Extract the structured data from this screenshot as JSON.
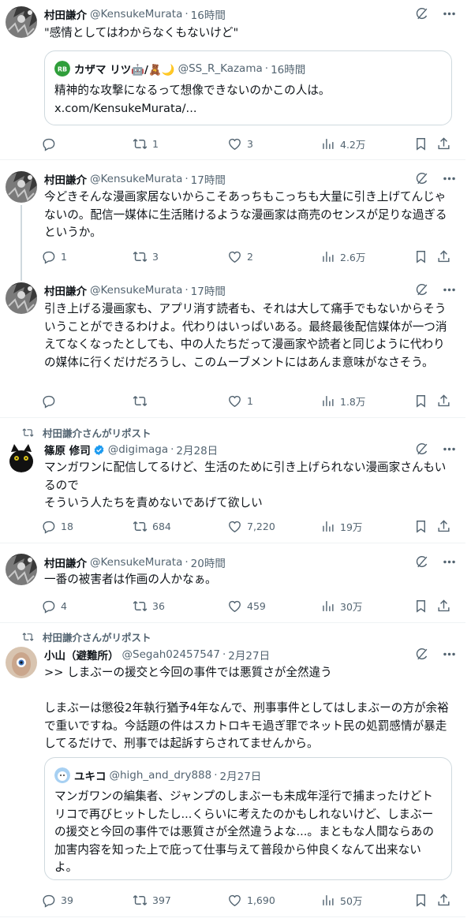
{
  "tweets": [
    {
      "author": "村田謙介",
      "handle": "@KensukeMurata",
      "sep": "·",
      "time": "16時間",
      "text": "\"感情としてはわからなくもないけど\"",
      "quote": {
        "author": "カザマ リツ🤖/🧸🌙",
        "handle": "@SS_R_Kazama",
        "sep": "·",
        "time": "16時間",
        "text": "精神的な攻撃になるって想像できないのかこの人は。\nx.com/KensukeMurata/..."
      },
      "stats": {
        "replies": "",
        "reposts": "1",
        "likes": "3",
        "views": "4.2万"
      }
    },
    {
      "author": "村田謙介",
      "handle": "@KensukeMurata",
      "sep": "·",
      "time": "17時間",
      "text": "今どきそんな漫画家居ないからこそあっちもこっちも大量に引き上げてんじゃないの。配信一媒体に生活賭けるような漫画家は商売のセンスが足りな過ぎるというか。",
      "stats": {
        "replies": "1",
        "reposts": "3",
        "likes": "2",
        "views": "2.6万"
      }
    },
    {
      "author": "村田謙介",
      "handle": "@KensukeMurata",
      "sep": "·",
      "time": "17時間",
      "text": "引き上げる漫画家も、アプリ消す読者も、それは大して痛手でもないからそういうことができるわけよ。代わりはいっぱいある。最終最後配信媒体が一つ消えてなくなったとしても、中の人たちだって漫画家や読者と同じように代わりの媒体に行くだけだろうし、このムーブメントにはあんま意味がなさそう。",
      "stats": {
        "replies": "",
        "reposts": "",
        "likes": "1",
        "views": "1.8万"
      }
    },
    {
      "repost_label": "村田謙介さんがリポスト",
      "author": "篠原 修司",
      "handle": "@digimaga",
      "sep": "·",
      "time": "2月28日",
      "text": "マンガワンに配信してるけど、生活のために引き上げられない漫画家さんもいるので\nそういう人たちを責めないであげて欲しい",
      "stats": {
        "replies": "18",
        "reposts": "684",
        "likes": "7,220",
        "views": "19万"
      }
    },
    {
      "author": "村田謙介",
      "handle": "@KensukeMurata",
      "sep": "·",
      "time": "20時間",
      "text": "一番の被害者は作画の人かなぁ。",
      "stats": {
        "replies": "4",
        "reposts": "36",
        "likes": "459",
        "views": "30万"
      }
    },
    {
      "repost_label": "村田謙介さんがリポスト",
      "author": "小山（避難所）",
      "handle": "@Segah02457547",
      "sep": "·",
      "time": "2月27日",
      "text": ">> しまぶーの援交と今回の事件では悪質さが全然違う\n\nしまぶーは懲役2年執行猶予4年なんで、刑事事件としてはしまぶーの方が余裕で重いですね。今話題の件はスカトロキモ過ぎ罪でネット民の処罰感情が暴走してるだけで、刑事では起訴すらされてませんから。",
      "quote": {
        "author": "ユキコ",
        "handle": "@high_and_dry888",
        "sep": "·",
        "time": "2月27日",
        "text": "マンガワンの編集者、ジャンプのしまぶーも未成年淫行で捕まったけどトリコで再びヒットしたし...くらいに考えたのかもしれないけど、しまぶーの援交と今回の事件では悪質さが全然違うよな...。まともな人間ならあの加害内容を知った上で庇って仕事与えて普段から仲良くなんて出来ないよ。"
      },
      "stats": {
        "replies": "39",
        "reposts": "397",
        "likes": "1,690",
        "views": "50万"
      }
    }
  ],
  "icons": {
    "grok": "grok-icon",
    "more": "more-icon",
    "reply": "reply-icon",
    "repost": "repost-icon",
    "like": "like-icon",
    "views": "views-icon",
    "bookmark": "bookmark-icon",
    "share": "share-icon"
  },
  "colors": {
    "text": "#0f1419",
    "muted": "#536471",
    "border": "#cfd9de",
    "verified": "#1d9bf0"
  }
}
